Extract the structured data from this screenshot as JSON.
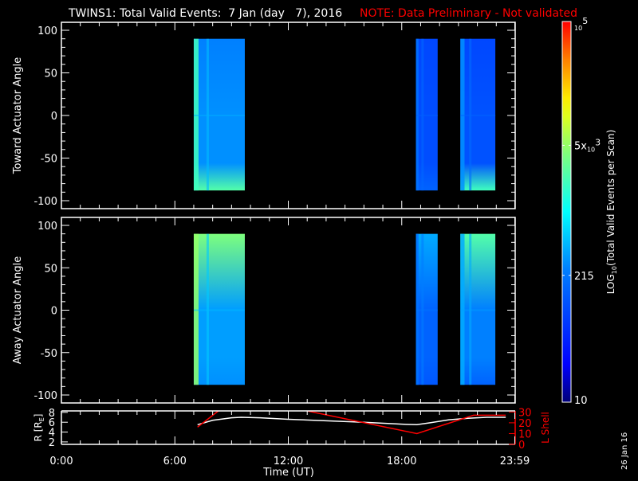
{
  "title": {
    "main": "TWINS1: Total Valid Events:  7 Jan (day   7), 2016",
    "note": "NOTE: Data Preliminary - Not validated"
  },
  "side_date": "26 Jan 16",
  "colors": {
    "background": "#000000",
    "axes": "#ffffff",
    "note": "#ff0000",
    "lshell": "#ff0000",
    "r": "#ffffff"
  },
  "chart_data": [
    {
      "type": "heatmap",
      "panel": "toward",
      "ylabel": "Toward Actuator Angle",
      "xlim": [
        0,
        24
      ],
      "ylim": [
        -100,
        100
      ],
      "yticks": [
        -100,
        -50,
        0,
        50,
        100
      ],
      "blocks": [
        {
          "start_h": 7.0,
          "end_h": 9.7,
          "angle_range": [
            -88,
            90
          ],
          "top_counts": 250,
          "mid_counts": 300,
          "bottom_counts": 2500,
          "edge_counts": 2000
        },
        {
          "start_h": 18.75,
          "end_h": 19.9,
          "angle_range": [
            -88,
            90
          ],
          "top_counts": 90,
          "mid_counts": 100,
          "bottom_counts": 150,
          "edge_counts": 200
        },
        {
          "start_h": 21.1,
          "end_h": 22.95,
          "angle_range": [
            -88,
            90
          ],
          "top_counts": 90,
          "mid_counts": 110,
          "bottom_counts": 2000,
          "edge_counts": 300
        }
      ]
    },
    {
      "type": "heatmap",
      "panel": "away",
      "ylabel": "Away Actuator Angle",
      "xlim": [
        0,
        24
      ],
      "ylim": [
        -100,
        100
      ],
      "yticks": [
        -100,
        -50,
        0,
        50,
        100
      ],
      "blocks": [
        {
          "start_h": 7.0,
          "end_h": 9.7,
          "angle_range": [
            -88,
            90
          ],
          "top_counts": 4000,
          "mid_counts": 350,
          "bottom_counts": 300,
          "edge_counts": 5000
        },
        {
          "start_h": 18.75,
          "end_h": 19.9,
          "angle_range": [
            -88,
            90
          ],
          "top_counts": 400,
          "mid_counts": 150,
          "bottom_counts": 120,
          "edge_counts": 200
        },
        {
          "start_h": 21.1,
          "end_h": 22.95,
          "angle_range": [
            -88,
            90
          ],
          "top_counts": 2500,
          "mid_counts": 250,
          "bottom_counts": 150,
          "edge_counts": 400
        }
      ]
    },
    {
      "type": "line",
      "panel": "orbit",
      "ylabel_left": "R [R",
      "ylabel_left_sub": "E",
      "ylabel_left_end": "]",
      "ylabel_right": "L Shell",
      "xlabel": "Time (UT)",
      "xticks": [
        "0:00",
        "6:00",
        "12:00",
        "18:00",
        "23:59"
      ],
      "xtick_values": [
        0,
        6,
        12,
        18,
        23.98
      ],
      "ylim_left": [
        1.5,
        8.3
      ],
      "yticks_left": [
        2,
        4,
        6,
        8
      ],
      "ylim_right": [
        0,
        31
      ],
      "yticks_right": [
        0,
        10,
        20,
        30
      ],
      "series": [
        {
          "name": "R",
          "axis": "left",
          "x": [
            7.2,
            8.0,
            9.0,
            9.5,
            10.5,
            12,
            14,
            16,
            18,
            18.8,
            19.5,
            20.5,
            21.5,
            22.5,
            23.5
          ],
          "y": [
            5.5,
            6.4,
            6.9,
            7.0,
            6.9,
            6.6,
            6.3,
            6.0,
            5.6,
            5.5,
            5.9,
            6.5,
            6.8,
            7.0,
            7.0
          ]
        },
        {
          "name": "L Shell",
          "axis": "right",
          "x": [
            7.2,
            8.3
          ],
          "y": [
            16,
            31
          ]
        },
        {
          "name": "L Shell",
          "axis": "right",
          "x": [
            13.0,
            18.8,
            21.8,
            23.5
          ],
          "y": [
            31,
            10,
            27,
            27
          ]
        }
      ]
    },
    {
      "type": "colorbar",
      "label": "LOG",
      "label_sub": "10",
      "label_end": "(Total Valid Events per Scan)",
      "range": [
        10,
        100000
      ],
      "ticks": [
        {
          "value": 10,
          "base": "10",
          "sub": "",
          "sup": ""
        },
        {
          "value": 215,
          "base": "215",
          "sub": "",
          "sup": ""
        },
        {
          "value": 5000,
          "base": "5x",
          "sub": "10",
          "sup": "3"
        },
        {
          "value": 100000,
          "base": "",
          "sub": "10",
          "sup": "5"
        }
      ]
    }
  ]
}
